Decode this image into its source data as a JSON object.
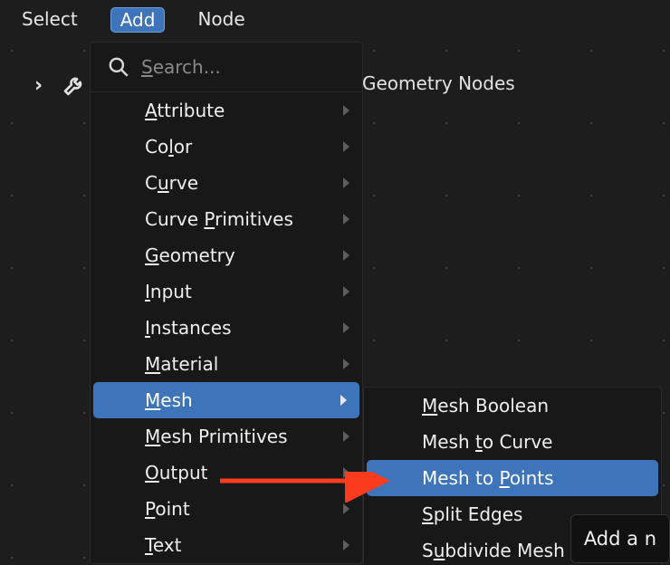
{
  "top_menu": {
    "select": "Select",
    "add": "Add",
    "node": "Node"
  },
  "breadcrumb": {
    "label": "Geometry Nodes"
  },
  "search": {
    "placeholder": "Search..."
  },
  "categories": [
    {
      "label": "Attribute",
      "u_idx": 0
    },
    {
      "label": "Color",
      "u_idx": 2
    },
    {
      "label": "Curve",
      "u_idx": 1
    },
    {
      "label": "Curve Primitives",
      "u_idx": 6
    },
    {
      "label": "Geometry",
      "u_idx": 0
    },
    {
      "label": "Input",
      "u_idx": 0
    },
    {
      "label": "Instances",
      "u_idx": 0
    },
    {
      "label": "Material",
      "u_idx": 0
    },
    {
      "label": "Mesh",
      "u_idx": 0,
      "active": true
    },
    {
      "label": "Mesh Primitives",
      "u_idx": 0
    },
    {
      "label": "Output",
      "u_idx": 0
    },
    {
      "label": "Point",
      "u_idx": 0
    },
    {
      "label": "Text",
      "u_idx": 0
    }
  ],
  "submenu": [
    {
      "label": "Mesh Boolean",
      "u_idx": 0
    },
    {
      "label": "Mesh to Curve",
      "u_idx": 5
    },
    {
      "label": "Mesh to Points",
      "u_idx": 8,
      "active": true
    },
    {
      "label": "Split Edges",
      "u_idx": 0
    },
    {
      "label": "Subdivide Mesh",
      "u_idx": 1
    }
  ],
  "tooltip": "Add a n",
  "colors": {
    "accent": "#3e74ba"
  }
}
